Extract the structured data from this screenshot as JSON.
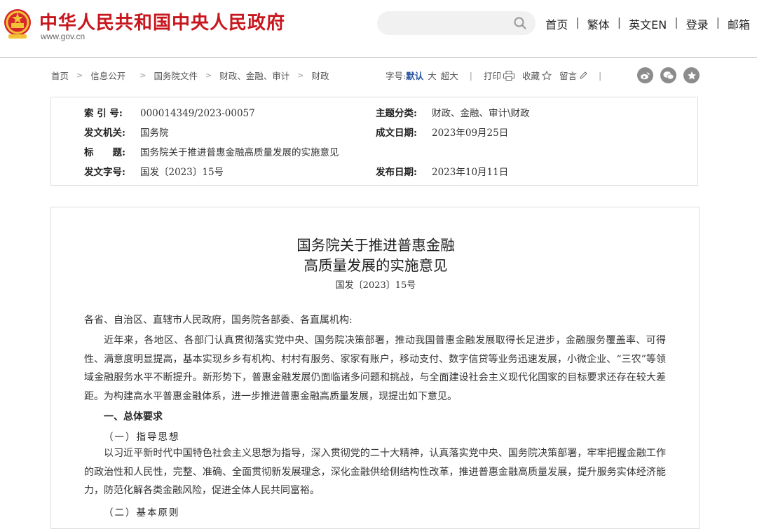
{
  "header": {
    "site_name": "中华人民共和国中央人民政府",
    "site_url": "www.gov.cn",
    "search_placeholder": "",
    "nav": [
      "首页",
      "繁体",
      "英文EN",
      "登录",
      "邮箱"
    ],
    "brand_color": "#c8161d"
  },
  "breadcrumb": [
    "首页",
    "信息公开",
    "国务院文件",
    "财政、金融、审计",
    "财政"
  ],
  "tools": {
    "font_size_label": "字号:",
    "sizes": [
      "默认",
      "大",
      "超大"
    ],
    "print": "打印",
    "favorite": "收藏",
    "comment": "留言",
    "share_icons": [
      "weibo-icon",
      "wechat-icon",
      "qzone-icon"
    ]
  },
  "meta": {
    "index_label": "索 引 号:",
    "index_value": "000014349/2023-00057",
    "category_label": "主题分类:",
    "category_value": "财政、金融、审计\\财政",
    "issuer_label": "发文机关:",
    "issuer_value": "国务院",
    "written_label": "成文日期:",
    "written_value": "2023年09月25日",
    "title_label": "标　　题:",
    "title_value": "国务院关于推进普惠金融高质量发展的实施意见",
    "docno_label": "发文字号:",
    "docno_value": "国发〔2023〕15号",
    "published_label": "发布日期:",
    "published_value": "2023年10月11日"
  },
  "document": {
    "title_line1": "国务院关于推进普惠金融",
    "title_line2": "高质量发展的实施意见",
    "doc_number": "国发〔2023〕15号",
    "salutation": "各省、自治区、直辖市人民政府，国务院各部委、各直属机构:",
    "para1": "近年来，各地区、各部门认真贯彻落实党中央、国务院决策部署，推动我国普惠金融发展取得长足进步，金融服务覆盖率、可得性、满意度明显提高，基本实现乡乡有机构、村村有服务、家家有账户，移动支付、数字信贷等业务迅速发展，小微企业、“三农”等领域金融服务水平不断提升。新形势下，普惠金融发展仍面临诸多问题和挑战，与全面建设社会主义现代化国家的目标要求还存在较大差距。为构建高水平普惠金融体系，进一步推进普惠金融高质量发展，现提出如下意见。",
    "section1": "一、总体要求",
    "sub1": "（一）指导思想",
    "para2": "以习近平新时代中国特色社会主义思想为指导，深入贯彻党的二十大精神，认真落实党中央、国务院决策部署，牢牢把握金融工作的政治性和人民性，完整、准确、全面贯彻新发展理念，深化金融供给侧结构性改革，推进普惠金融高质量发展，提升服务实体经济能力，防范化解各类金融风险，促进全体人民共同富裕。",
    "sub2": "（二）基本原则"
  }
}
